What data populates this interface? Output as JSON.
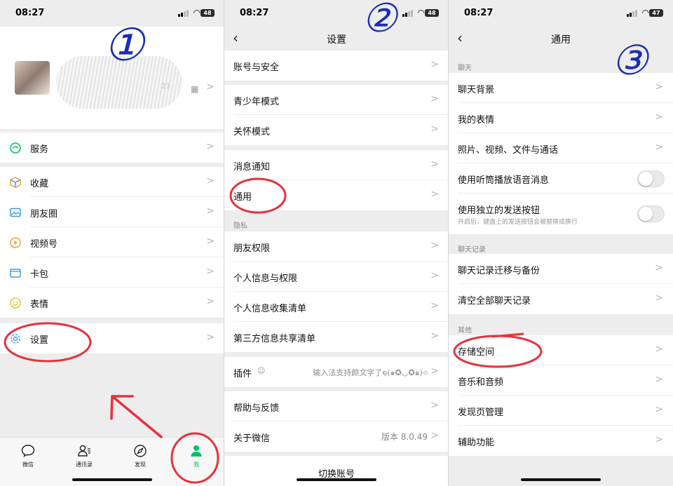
{
  "status": {
    "time": "08:27",
    "battery_1": "48",
    "battery_2": "48",
    "battery_3": "47"
  },
  "annotations": {
    "n1": "①",
    "n2": "②",
    "n3": "③"
  },
  "panel1": {
    "profile": {
      "masked_text": "23"
    },
    "items": [
      {
        "label": "服务",
        "icon": "service-icon"
      },
      {
        "label": "收藏",
        "icon": "favorites-icon"
      },
      {
        "label": "朋友圈",
        "icon": "moments-icon"
      },
      {
        "label": "视频号",
        "icon": "channels-icon"
      },
      {
        "label": "卡包",
        "icon": "card-wallet-icon"
      },
      {
        "label": "表情",
        "icon": "sticker-icon"
      },
      {
        "label": "设置",
        "icon": "settings-gear-icon"
      }
    ],
    "tabs": [
      {
        "label": "微信",
        "icon": "chat-icon"
      },
      {
        "label": "通讯录",
        "icon": "contacts-icon"
      },
      {
        "label": "发现",
        "icon": "compass-icon"
      },
      {
        "label": "我",
        "icon": "me-icon"
      }
    ],
    "active_color": "#07c160"
  },
  "panel2": {
    "title": "设置",
    "items": [
      {
        "label": "账号与安全"
      },
      {
        "label": "青少年模式"
      },
      {
        "label": "关怀模式"
      },
      {
        "label": "消息通知"
      },
      {
        "label": "通用"
      },
      {
        "label": "朋友权限"
      },
      {
        "label": "个人信息与权限"
      },
      {
        "label": "个人信息收集清单"
      },
      {
        "label": "第三方信息共享清单"
      },
      {
        "label": "插件",
        "value": "输入法支持颜文字了໑(๑✪◡✪๑)৩"
      },
      {
        "label": "帮助与反馈"
      },
      {
        "label": "关于微信",
        "value": "版本 8.0.49"
      }
    ],
    "section_privacy": "隐私",
    "switch_account": "切换账号"
  },
  "panel3": {
    "title": "通用",
    "section_chat": "聊天",
    "section_history": "聊天记录",
    "section_other": "其他",
    "items": [
      {
        "label": "聊天背景"
      },
      {
        "label": "我的表情"
      },
      {
        "label": "照片、视频、文件与通话"
      },
      {
        "label": "使用听筒播放语音消息",
        "toggle": false
      },
      {
        "label": "使用独立的发送按钮",
        "sublabel": "开启后，键盘上的发送按钮会被替换成换行",
        "toggle": false
      },
      {
        "label": "聊天记录迁移与备份"
      },
      {
        "label": "清空全部聊天记录"
      },
      {
        "label": "存储空间"
      },
      {
        "label": "音乐和音频"
      },
      {
        "label": "发现页管理"
      },
      {
        "label": "辅助功能"
      }
    ]
  }
}
